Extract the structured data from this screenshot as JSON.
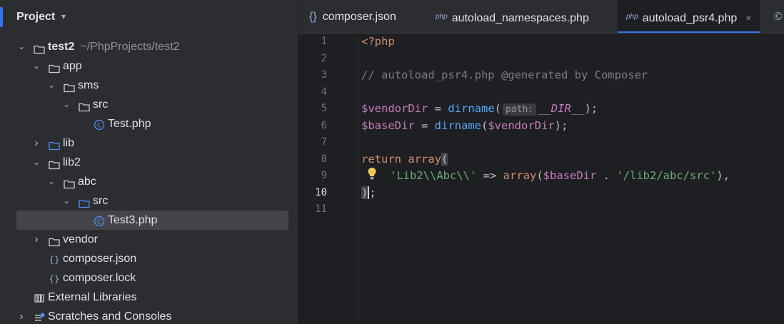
{
  "project_panel": {
    "title": "Project",
    "tree": [
      {
        "label": "test2",
        "path": "~/PhpProjects/test2",
        "depth": 0,
        "expanded": true,
        "icon": "folder-icon"
      },
      {
        "label": "app",
        "depth": 1,
        "expanded": true,
        "icon": "folder-icon"
      },
      {
        "label": "sms",
        "depth": 2,
        "expanded": true,
        "icon": "folder-icon"
      },
      {
        "label": "src",
        "depth": 3,
        "expanded": true,
        "icon": "folder-icon"
      },
      {
        "label": "Test.php",
        "depth": 4,
        "icon": "php-class-icon"
      },
      {
        "label": "lib",
        "depth": 1,
        "expanded": false,
        "icon": "source-folder-icon"
      },
      {
        "label": "lib2",
        "depth": 1,
        "expanded": true,
        "icon": "folder-icon"
      },
      {
        "label": "abc",
        "depth": 2,
        "expanded": true,
        "icon": "folder-icon"
      },
      {
        "label": "src",
        "depth": 3,
        "expanded": true,
        "icon": "source-folder-icon"
      },
      {
        "label": "Test3.php",
        "depth": 4,
        "icon": "php-class-icon",
        "selected": true
      },
      {
        "label": "vendor",
        "depth": 1,
        "expanded": false,
        "icon": "folder-icon"
      },
      {
        "label": "composer.json",
        "depth": 1,
        "icon": "json-icon"
      },
      {
        "label": "composer.lock",
        "depth": 1,
        "icon": "json-icon"
      },
      {
        "label": "External Libraries",
        "depth": 0,
        "icon": "libraries-icon"
      },
      {
        "label": "Scratches and Consoles",
        "depth": 0,
        "expanded": false,
        "icon": "scratches-icon"
      }
    ]
  },
  "editor": {
    "tabs": [
      {
        "label": "composer.json",
        "icon": "json-icon"
      },
      {
        "label": "autoload_namespaces.php",
        "icon": "php-file-icon",
        "prefix": "php"
      },
      {
        "label": "autoload_psr4.php",
        "icon": "php-file-icon",
        "prefix": "php",
        "active": true,
        "close": "×"
      }
    ],
    "line_numbers": [
      "1",
      "2",
      "3",
      "4",
      "5",
      "6",
      "7",
      "8",
      "9",
      "10",
      "11"
    ],
    "current_line": "10",
    "code": {
      "l1": "<?php",
      "l3": "// autoload_psr4.php @generated by Composer",
      "l5_var": "$vendorDir",
      "l5_eq": " = ",
      "l5_fn": "dirname",
      "l5_open": "(",
      "l5_hint": "path:",
      "l5_const": "__DIR__",
      "l5_close": ");",
      "l6_var": "$baseDir",
      "l6_eq": " = ",
      "l6_fn": "dirname",
      "l6_open": "(",
      "l6_arg": "$vendorDir",
      "l6_close": ");",
      "l8_kw": "return",
      "l8_fn": " array",
      "l8_open": "(",
      "l9_str1": "'Lib2\\\\Abc\\\\'",
      "l9_arrow": " => ",
      "l9_fn": "array",
      "l9_open": "(",
      "l9_var": "$baseDir",
      "l9_dot": " . ",
      "l9_str2": "'/lib2/abc/src'",
      "l9_close": "),",
      "l10_paren": ")",
      "l10_semi": ";"
    }
  }
}
